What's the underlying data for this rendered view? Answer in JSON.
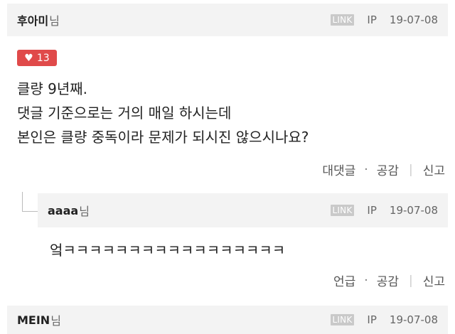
{
  "comment": {
    "nickname": "후아미",
    "suffix": "님",
    "link_label": "LINK",
    "ip_label": "IP",
    "date": "19-07-08",
    "likes": "13",
    "lines": [
      "클량 9년째.",
      "댓글 기준으로는 거의 매일 하시는데",
      "본인은 클량 중독이라 문제가 되시진 않으시나요?"
    ],
    "actions": {
      "reply": "대댓글",
      "dot": "·",
      "like": "공감",
      "report": "신고"
    }
  },
  "reply": {
    "nickname": "aaaa",
    "suffix": "님",
    "link_label": "LINK",
    "ip_label": "IP",
    "date": "19-07-08",
    "text": "엌ㅋㅋㅋㅋㅋㅋㅋㅋㅋㅋㅋㅋㅋㅋㅋㅋㅋ",
    "actions": {
      "mention": "언급",
      "dot": "·",
      "like": "공감",
      "report": "신고"
    }
  },
  "next_comment": {
    "nickname": "MEIN",
    "suffix": "님",
    "link_label": "LINK",
    "ip_label": "IP",
    "date": "19-07-08"
  }
}
